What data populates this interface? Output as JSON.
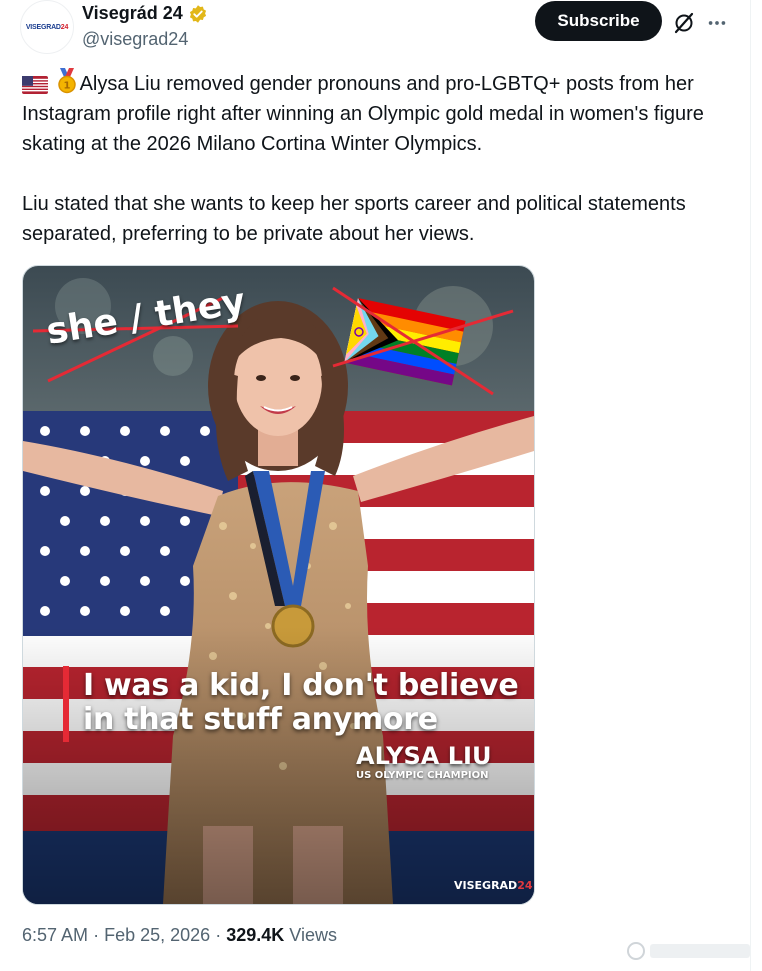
{
  "author": {
    "display_name": "Visegrád 24",
    "handle": "@visegrad24",
    "avatar_text_a": "VISEGRAD",
    "avatar_text_b": "24",
    "verified": true
  },
  "actions": {
    "subscribe_label": "Subscribe",
    "grok_icon": "grok-icon",
    "more_icon": "more-icon"
  },
  "tweet": {
    "paragraph_1": "Alysa Liu removed gender pronouns and pro-LGBTQ+ posts from her Instagram profile right after winning an Olympic gold medal in women's figure skating at the 2026 Milano Cortina Winter Olympics.",
    "paragraph_2": "Liu stated that she wants to keep her sports career and political statements separated, preferring to be private about her views.",
    "emoji_1": "us-flag-emoji",
    "emoji_2": "gold-medal-emoji"
  },
  "media": {
    "crossed_text": "she / they",
    "quote_line_1": "I was a kid, I don't believe",
    "quote_line_2": "in that stuff anymore",
    "attribution_name": "ALYSA LIU",
    "attribution_title": "US OLYMPIC CHAMPION",
    "watermark_a": "VISEGRAD",
    "watermark_b": "24"
  },
  "meta": {
    "time": "6:57 AM",
    "separator": "·",
    "date": "Feb 25, 2026",
    "views_count": "329.4K",
    "views_label": "Views"
  },
  "colors": {
    "accent_red": "#d21f2b",
    "text_primary": "#0f1419",
    "text_secondary": "#536471",
    "verified_gold": "#e2b719"
  }
}
